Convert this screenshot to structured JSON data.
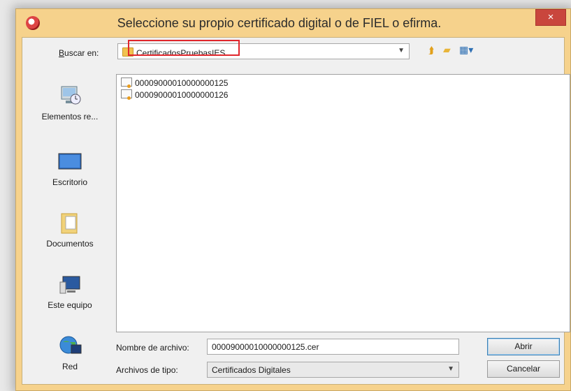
{
  "window": {
    "title": "Seleccione su propio certificado digital o de FIEL o efirma.",
    "close_label": "×"
  },
  "lookin": {
    "label": "Buscar en:",
    "value": "CertificadosPruebasIES"
  },
  "toolbar_icons": [
    "back-icon",
    "new-folder-icon",
    "view-menu-icon"
  ],
  "places": [
    {
      "label": "Elementos re...",
      "icon": "recent-items-icon"
    },
    {
      "label": "Escritorio",
      "icon": "desktop-icon"
    },
    {
      "label": "Documentos",
      "icon": "documents-icon"
    },
    {
      "label": "Este equipo",
      "icon": "computer-icon"
    },
    {
      "label": "Red",
      "icon": "network-icon"
    }
  ],
  "files": [
    {
      "name": "00009000010000000125"
    },
    {
      "name": "00009000010000000126"
    }
  ],
  "filename": {
    "label": "Nombre de archivo:",
    "value": "00009000010000000125.cer"
  },
  "filetype": {
    "label": "Archivos de tipo:",
    "value": "Certificados Digitales"
  },
  "buttons": {
    "open": "Abrir",
    "cancel": "Cancelar"
  },
  "colors": {
    "frame": "#f6d28c",
    "close": "#c9463d",
    "highlight": "#e0262c"
  }
}
